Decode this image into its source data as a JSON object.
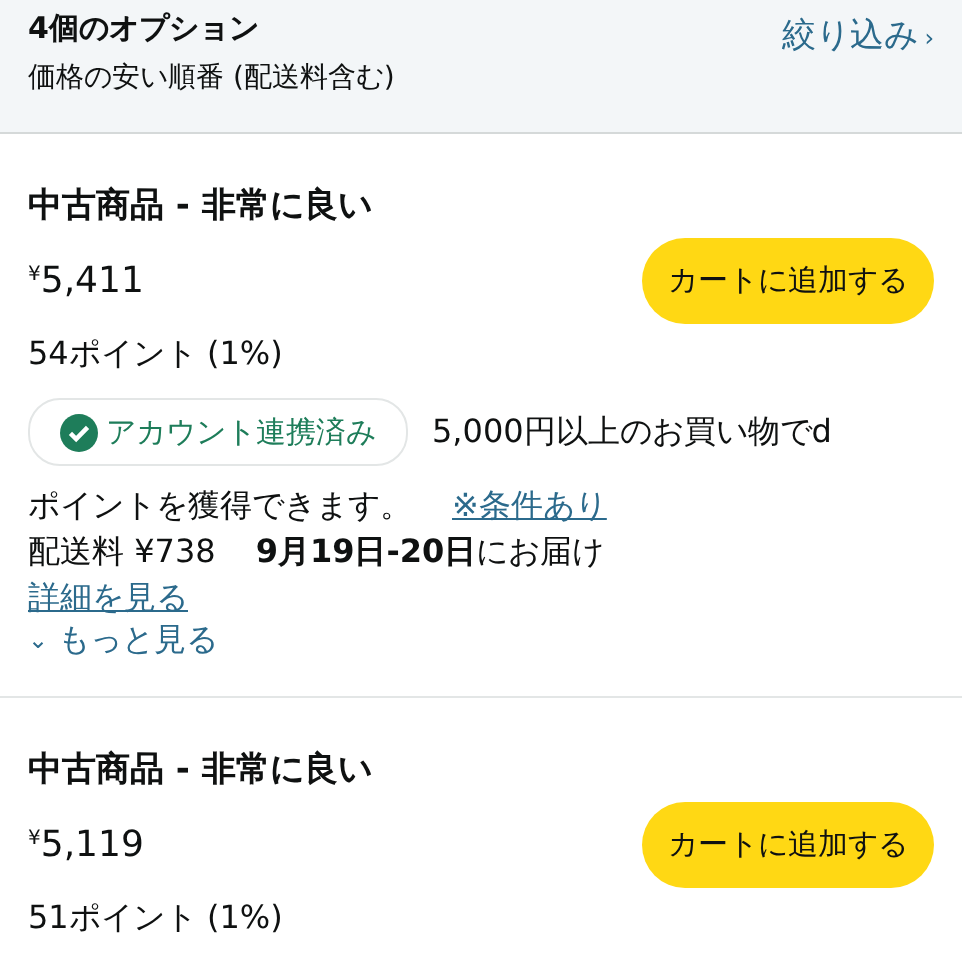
{
  "header": {
    "title": "4個のオプション",
    "sort": "価格の安い順番 (配送料含む)",
    "filter_link": "絞り込み",
    "filter_chevron": "›"
  },
  "offers": [
    {
      "condition": "中古商品 - 非常に良い",
      "price": "$^{¥}$5,411",
      "points": "54ポイント (1%)",
      "button": "カートに追加する",
      "badge": "アカウント連携済み",
      "promo": "5,000円以上のお買い物でd",
      "promo_cont": "ポイントを獲得できます。",
      "conditions_link": "※条件あり",
      "shipping": "配送料 ¥738",
      "delivery": "**9月19日-20日**にお届け",
      "details_link": "詳細を見る",
      "more_chevron": "⌄",
      "more_link": "もっと見る"
    },
    {
      "condition": "中古商品 - 非常に良い",
      "price": "$^{¥}$5,119",
      "points": "51ポイント (1%)",
      "button": "カートに追加する"
    }
  ]
}
